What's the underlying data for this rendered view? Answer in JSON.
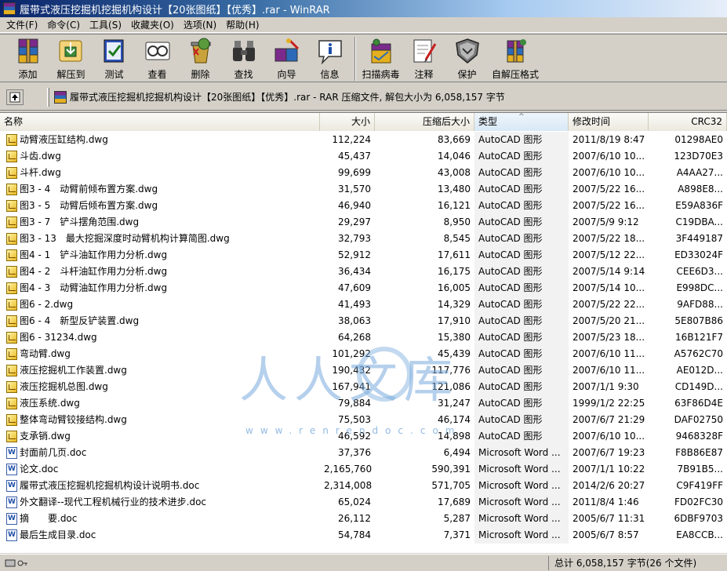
{
  "window": {
    "title": "履带式液压挖掘机挖掘机构设计【20张图纸】【优秀】.rar - WinRAR"
  },
  "menu": [
    "文件(F)",
    "命令(C)",
    "工具(S)",
    "收藏夹(O)",
    "选项(N)",
    "帮助(H)"
  ],
  "toolbar": {
    "buttons": [
      {
        "label": "添加",
        "icon": "add-archive-icon"
      },
      {
        "label": "解压到",
        "icon": "extract-to-icon"
      },
      {
        "label": "测试",
        "icon": "test-icon"
      },
      {
        "label": "查看",
        "icon": "view-icon"
      },
      {
        "label": "删除",
        "icon": "delete-icon"
      },
      {
        "label": "查找",
        "icon": "find-icon"
      },
      {
        "label": "向导",
        "icon": "wizard-icon"
      },
      {
        "label": "信息",
        "icon": "info-icon"
      },
      {
        "label": "扫描病毒",
        "icon": "virus-scan-icon"
      },
      {
        "label": "注释",
        "icon": "comment-icon"
      },
      {
        "label": "保护",
        "icon": "protect-icon"
      },
      {
        "label": "自解压格式",
        "icon": "sfx-icon"
      }
    ]
  },
  "address": {
    "text": "履带式液压挖掘机挖掘机构设计【20张图纸】【优秀】.rar - RAR 压缩文件, 解包大小为 6,058,157 字节"
  },
  "columns": {
    "name": "名称",
    "size": "大小",
    "packed": "压缩后大小",
    "type": "类型",
    "modified": "修改时间",
    "crc": "CRC32"
  },
  "files": [
    {
      "kind": "dwg",
      "name": "动臂液压缸结构.dwg",
      "size": "112,224",
      "packed": "83,669",
      "type": "AutoCAD 图形",
      "modified": "2011/8/19 8:47",
      "crc": "01298AE0"
    },
    {
      "kind": "dwg",
      "name": "斗齿.dwg",
      "size": "45,437",
      "packed": "14,046",
      "type": "AutoCAD 图形",
      "modified": "2007/6/10 10...",
      "crc": "123D70E3"
    },
    {
      "kind": "dwg",
      "name": "斗杆.dwg",
      "size": "99,699",
      "packed": "43,008",
      "type": "AutoCAD 图形",
      "modified": "2007/6/10 10...",
      "crc": "A4AA27..."
    },
    {
      "kind": "dwg",
      "name": "图3 - 4　动臂前倾布置方案.dwg",
      "size": "31,570",
      "packed": "13,480",
      "type": "AutoCAD 图形",
      "modified": "2007/5/22 16...",
      "crc": "A898E8..."
    },
    {
      "kind": "dwg",
      "name": "图3 - 5　动臂后倾布置方案.dwg",
      "size": "46,940",
      "packed": "16,121",
      "type": "AutoCAD 图形",
      "modified": "2007/5/22 16...",
      "crc": "E59A836F"
    },
    {
      "kind": "dwg",
      "name": "图3 - 7　铲斗摆角范围.dwg",
      "size": "29,297",
      "packed": "8,950",
      "type": "AutoCAD 图形",
      "modified": "2007/5/9 9:12",
      "crc": "C19DBA..."
    },
    {
      "kind": "dwg",
      "name": "图3 - 13　最大挖掘深度时动臂机构计算简图.dwg",
      "size": "32,793",
      "packed": "8,545",
      "type": "AutoCAD 图形",
      "modified": "2007/5/22 18...",
      "crc": "3F449187"
    },
    {
      "kind": "dwg",
      "name": "图4 - 1　铲斗油缸作用力分析.dwg",
      "size": "52,912",
      "packed": "17,611",
      "type": "AutoCAD 图形",
      "modified": "2007/5/12 22...",
      "crc": "ED33024F"
    },
    {
      "kind": "dwg",
      "name": "图4 - 2　斗杆油缸作用力分析.dwg",
      "size": "36,434",
      "packed": "16,175",
      "type": "AutoCAD 图形",
      "modified": "2007/5/14 9:14",
      "crc": "CEE6D3..."
    },
    {
      "kind": "dwg",
      "name": "图4 - 3　动臂油缸作用力分析.dwg",
      "size": "47,609",
      "packed": "16,005",
      "type": "AutoCAD 图形",
      "modified": "2007/5/14 10...",
      "crc": "E998DC..."
    },
    {
      "kind": "dwg",
      "name": "图6 - 2.dwg",
      "size": "41,493",
      "packed": "14,329",
      "type": "AutoCAD 图形",
      "modified": "2007/5/22 22...",
      "crc": "9AFD88..."
    },
    {
      "kind": "dwg",
      "name": "图6 - 4　新型反铲装置.dwg",
      "size": "38,063",
      "packed": "17,910",
      "type": "AutoCAD 图形",
      "modified": "2007/5/20 21...",
      "crc": "5E807B86"
    },
    {
      "kind": "dwg",
      "name": "图6 - 31234.dwg",
      "size": "64,268",
      "packed": "15,380",
      "type": "AutoCAD 图形",
      "modified": "2007/5/23 18...",
      "crc": "16B121F7"
    },
    {
      "kind": "dwg",
      "name": "弯动臂.dwg",
      "size": "101,292",
      "packed": "45,439",
      "type": "AutoCAD 图形",
      "modified": "2007/6/10 11...",
      "crc": "A5762C70"
    },
    {
      "kind": "dwg",
      "name": "液压挖掘机工作装置.dwg",
      "size": "190,432",
      "packed": "117,776",
      "type": "AutoCAD 图形",
      "modified": "2007/6/10 11...",
      "crc": "AE012D..."
    },
    {
      "kind": "dwg",
      "name": "液压挖掘机总图.dwg",
      "size": "167,941",
      "packed": "121,086",
      "type": "AutoCAD 图形",
      "modified": "2007/1/1 9:30",
      "crc": "CD149D..."
    },
    {
      "kind": "dwg",
      "name": "液压系统.dwg",
      "size": "79,884",
      "packed": "31,247",
      "type": "AutoCAD 图形",
      "modified": "1999/1/2 22:25",
      "crc": "63F86D4E"
    },
    {
      "kind": "dwg",
      "name": "整体弯动臂铰接结构.dwg",
      "size": "75,503",
      "packed": "46,174",
      "type": "AutoCAD 图形",
      "modified": "2007/6/7 21:29",
      "crc": "DAF02750"
    },
    {
      "kind": "dwg",
      "name": "支承销.dwg",
      "size": "46,592",
      "packed": "14,898",
      "type": "AutoCAD 图形",
      "modified": "2007/6/10 10...",
      "crc": "9468328F"
    },
    {
      "kind": "doc",
      "name": "封面前几页.doc",
      "size": "37,376",
      "packed": "6,494",
      "type": "Microsoft Word ...",
      "modified": "2007/6/7 19:23",
      "crc": "F8B86E87"
    },
    {
      "kind": "doc",
      "name": "论文.doc",
      "size": "2,165,760",
      "packed": "590,391",
      "type": "Microsoft Word ...",
      "modified": "2007/1/1 10:22",
      "crc": "7B91B5..."
    },
    {
      "kind": "doc",
      "name": "履带式液压挖掘机挖掘机构设计说明书.doc",
      "size": "2,314,008",
      "packed": "571,705",
      "type": "Microsoft Word ...",
      "modified": "2014/2/6 20:27",
      "crc": "C9F419FF"
    },
    {
      "kind": "doc",
      "name": "外文翻译--现代工程机械行业的技术进步.doc",
      "size": "65,024",
      "packed": "17,689",
      "type": "Microsoft Word ...",
      "modified": "2011/8/4 1:46",
      "crc": "FD02FC30"
    },
    {
      "kind": "doc",
      "name": "摘　　要.doc",
      "size": "26,112",
      "packed": "5,287",
      "type": "Microsoft Word ...",
      "modified": "2005/6/7 11:31",
      "crc": "6DBF9703"
    },
    {
      "kind": "doc",
      "name": "最后生成目录.doc",
      "size": "54,784",
      "packed": "7,371",
      "type": "Microsoft Word ...",
      "modified": "2005/6/7 8:57",
      "crc": "EA8CCB..."
    }
  ],
  "watermark": {
    "text": "人人文库",
    "url": "www.renrendoc.com"
  },
  "status": {
    "total": "总计 6,058,157 字节(26 个文件)"
  }
}
